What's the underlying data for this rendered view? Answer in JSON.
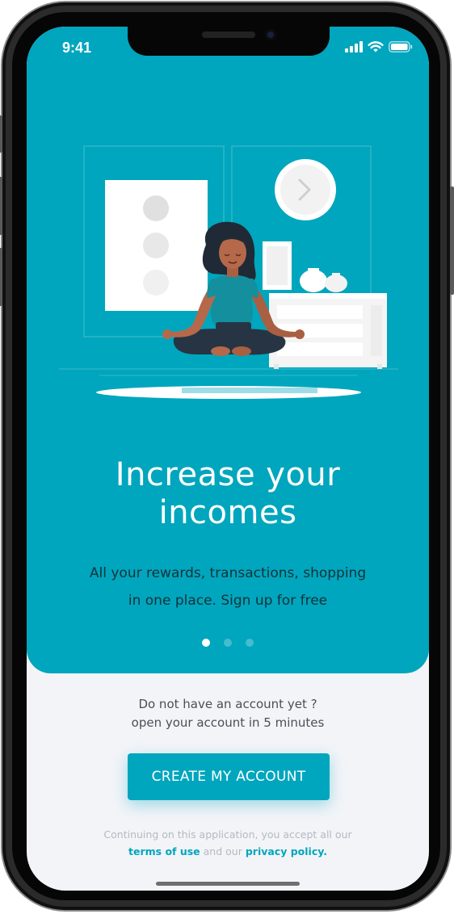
{
  "status_bar": {
    "time": "9:41",
    "icons": [
      "signal-icon",
      "wifi-icon",
      "battery-icon"
    ]
  },
  "onboarding": {
    "illustration": "woman-meditating-illustration",
    "headline_line1": "Increase your",
    "headline_line2": "incomes",
    "subtext_line1": "All your rewards, transactions, shopping",
    "subtext_line2": "in one place. Sign up for free",
    "pagination": {
      "count": 3,
      "active_index": 0
    }
  },
  "signup": {
    "prompt_line1": "Do not have an account yet ?",
    "prompt_line2": "open your account in 5 minutes",
    "cta_label": "CREATE MY ACCOUNT"
  },
  "legal": {
    "line1": "Continuing on this application, you accept all our",
    "terms_link": "terms of use",
    "connector": "and our",
    "privacy_link": "privacy policy."
  },
  "colors": {
    "accent": "#00a6bd",
    "background": "#f2f4f8",
    "headline": "#ffffff",
    "subtext": "#12323b",
    "legal_text": "#b4b9c1"
  }
}
